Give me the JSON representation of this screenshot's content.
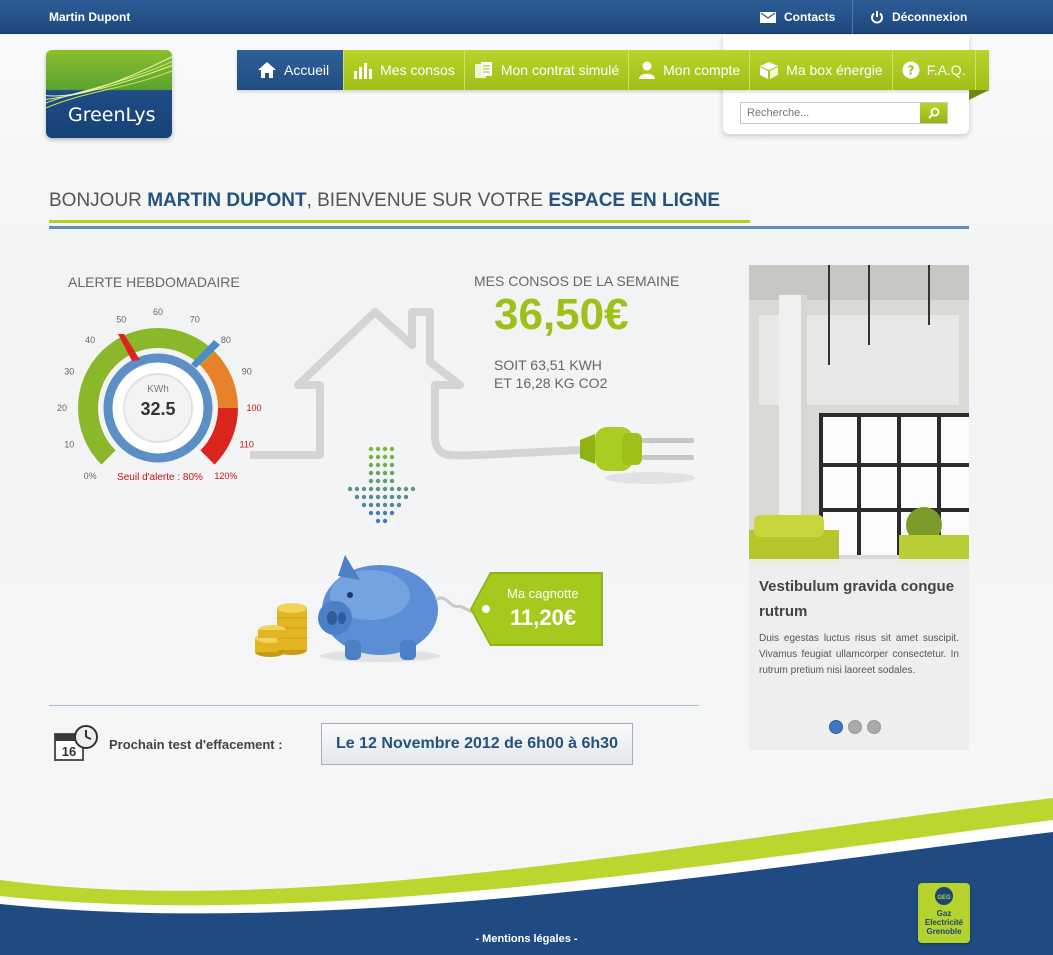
{
  "topbar": {
    "user_name": "Martin Dupont",
    "contacts_label": "Contacts",
    "logout_label": "Déconnexion"
  },
  "logo": {
    "text": "GreenLys"
  },
  "nav": {
    "items": [
      {
        "label": "Accueil",
        "icon": "home-icon"
      },
      {
        "label": "Mes consos",
        "icon": "bar-chart-icon"
      },
      {
        "label": "Mon contrat simulé",
        "icon": "documents-icon"
      },
      {
        "label": "Mon compte",
        "icon": "user-icon"
      },
      {
        "label": "Ma box énergie",
        "icon": "box-icon"
      },
      {
        "label": "F.A.Q.",
        "icon": "question-icon"
      }
    ],
    "active": "Accueil"
  },
  "search": {
    "placeholder": "Recherche..."
  },
  "welcome": {
    "part1": "BONJOUR ",
    "name": "MARTIN DUPONT",
    "part2": ", BIENVENUE SUR VOTRE ",
    "space": "ESPACE EN LIGNE"
  },
  "alert": {
    "title": "ALERTE HEBDOMADAIRE",
    "unit": "KWh",
    "value": "32.5",
    "threshold_label": "Seuil d'alerte : 80%",
    "ticks": [
      "0%",
      "10",
      "20",
      "30",
      "40",
      "50",
      "60",
      "70",
      "80",
      "90",
      "100",
      "110",
      "120%"
    ]
  },
  "consos": {
    "title": "MES CONSOS DE LA SEMAINE",
    "amount": "36,50€",
    "line1": "SOIT 63,51 KWH",
    "line2": "ET 16,28 KG CO2"
  },
  "cagnotte": {
    "label": "Ma cagnotte",
    "amount": "11,20€"
  },
  "next_test": {
    "calendar_day": "16",
    "label": "Prochain test d'effacement :",
    "date": "Le 12 Novembre 2012 de 6h00 à 6h30"
  },
  "slider": {
    "title": "Vestibulum gravida congue rutrum",
    "text": "Duis egestas luctus risus sit amet suscipit. Vivamus feugiat ullamcorper consectetur. In rutrum pretium nisi laoreet sodales.",
    "current": 1,
    "total": 3
  },
  "footer": {
    "mentions": "- Mentions légales -",
    "partner_logo_text": [
      "GEG",
      "Gaz",
      "Electricité",
      "Grenoble"
    ]
  },
  "colors": {
    "brand_blue": "#24527f",
    "brand_green": "#9cc21a",
    "alert_red": "#cc1111"
  }
}
